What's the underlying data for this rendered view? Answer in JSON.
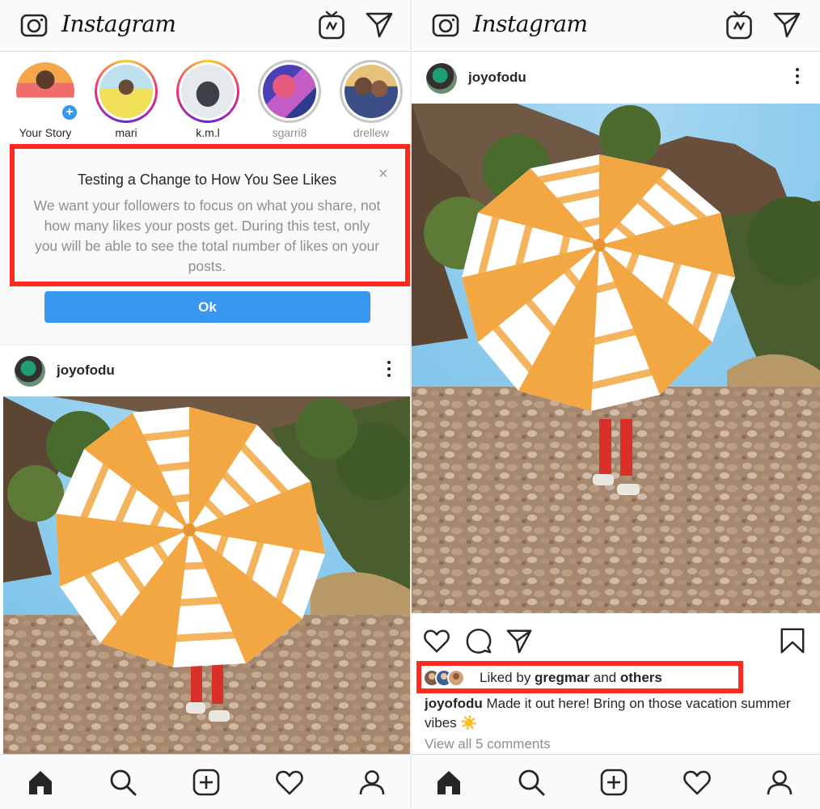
{
  "app": {
    "logo_text": "Instagram"
  },
  "stories": [
    {
      "name": "Your Story",
      "ring": "none",
      "has_plus": true
    },
    {
      "name": "mari",
      "ring": "grad"
    },
    {
      "name": "k.m.l",
      "ring": "grad"
    },
    {
      "name": "sgarri8",
      "ring": "seen"
    },
    {
      "name": "drellew",
      "ring": "seen"
    }
  ],
  "notice": {
    "title": "Testing a Change to How You See Likes",
    "body": "We want your followers to focus on what you share, not how many likes your posts get. During this test, only you will be able to see the total number of likes on your posts.",
    "close_glyph": "×",
    "ok_label": "Ok"
  },
  "post": {
    "username": "joyofodu",
    "liked_prefix": "Liked by ",
    "liked_user": "gregmar",
    "liked_mid": " and ",
    "liked_others": "others",
    "caption_user": "joyofodu",
    "caption_text": " Made it out here! Bring on those vacation summer vibes ☀️",
    "view_comments": "View all 5 comments"
  },
  "icons": {
    "camera": "camera-icon",
    "igtv": "igtv-icon",
    "direct": "direct-message-icon",
    "home": "home-icon",
    "search": "search-icon",
    "add": "add-post-icon",
    "activity": "heart-icon",
    "profile": "profile-icon",
    "like": "like-heart-icon",
    "comment": "comment-icon",
    "share": "share-icon",
    "save": "bookmark-icon"
  },
  "colors": {
    "accent": "#3897f0",
    "highlight": "#ff2a1d",
    "umbrella_stripe": "#f3a742"
  }
}
